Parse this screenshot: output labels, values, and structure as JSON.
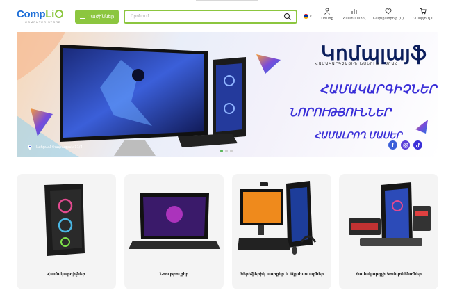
{
  "header": {
    "logo_main": "Comp",
    "logo_life": "Li",
    "logo_sub": "COMPUTER STORE",
    "catalog_label": "Բաժիններ",
    "search_placeholder": "Որոնում",
    "items": [
      {
        "icon": "user-icon",
        "label": "Մուտք"
      },
      {
        "icon": "compare-icon",
        "label": "Համեմատել"
      },
      {
        "icon": "heart-icon",
        "label": "Նախընտրելի (0)"
      },
      {
        "icon": "cart-icon",
        "label": "Զամբյուղ 0"
      }
    ]
  },
  "banner": {
    "brand": "Կոմպլայֆ",
    "subtitle": "ՀԱՄԱԿԱՐԳՉԱՅԻՆ ԽԱՆՈՒԹ - ՍՐԱՀ",
    "line1": "ՀԱՄԱԿԱՐԳԻՉՆԵՐ",
    "line2": "ՆՈՐՈՒԹՅՈՒՆՆԵՐ",
    "line3": "ՀԱՄԱԼՐՈՂ ՄԱՍԵՐ",
    "address": "Վահրամ Փափազյան 11/4",
    "slides_total": 3,
    "slide_active": 1
  },
  "categories": [
    {
      "label": "Համակարգիչներ"
    },
    {
      "label": "Նոութբուքեր"
    },
    {
      "label": "Պերեֆերիկ սարքեր և Աքսեսուարներ"
    },
    {
      "label": "Համակարգչի Կոմպոնենտներ"
    }
  ],
  "colors": {
    "accent_green": "#8cc63f",
    "brand_blue": "#1e6fd8",
    "banner_text": "#3a2fd8"
  }
}
